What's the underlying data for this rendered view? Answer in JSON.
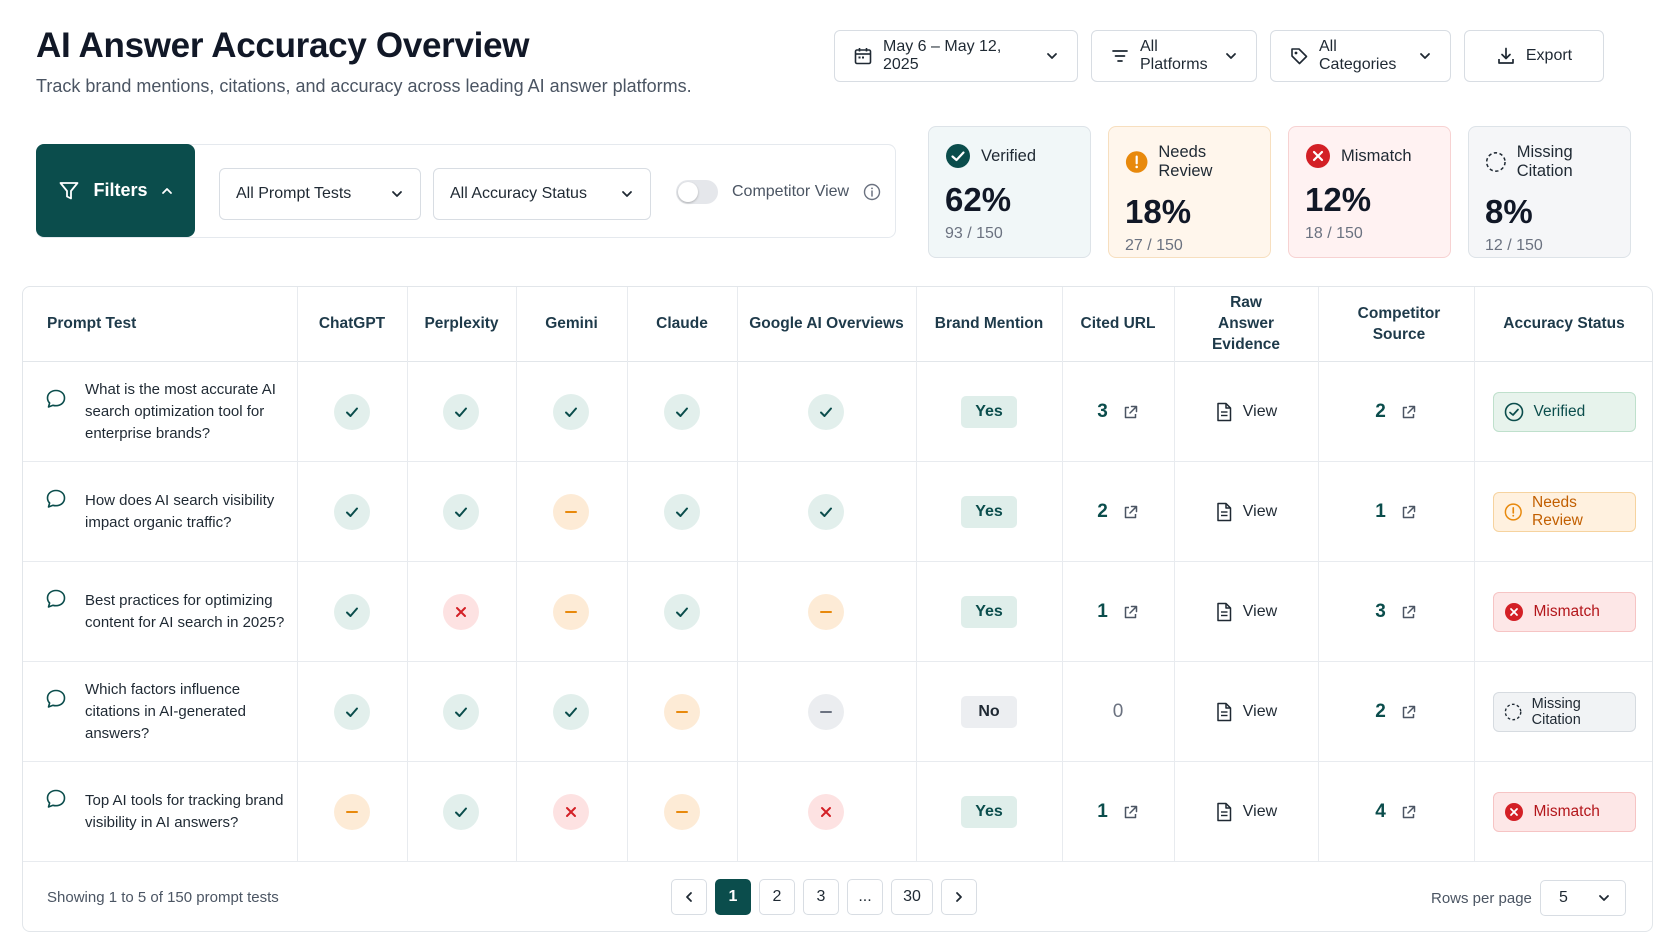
{
  "header": {
    "title": "AI Answer Accuracy Overview",
    "subtitle": "Track brand mentions, citations, and accuracy across leading AI answer platforms."
  },
  "toolbar": {
    "date_range": "May 6 – May 12, 2025",
    "platforms": "All Platforms",
    "categories": "All Categories",
    "export": "Export"
  },
  "filters": {
    "button": "Filters",
    "prompt_tests": "All Prompt Tests",
    "accuracy_status": "All Accuracy Status",
    "competitor_view": "Competitor View"
  },
  "stats": [
    {
      "label": "Verified",
      "value": "62%",
      "sub": "93 / 150",
      "color": "#0b4d4c"
    },
    {
      "label": "Needs Review",
      "value": "18%",
      "sub": "27 / 150",
      "color": "#e8890c"
    },
    {
      "label": "Mismatch",
      "value": "12%",
      "sub": "18 / 150",
      "color": "#d32026"
    },
    {
      "label": "Missing Citation",
      "value": "8%",
      "sub": "12 / 150",
      "color": "#1f2933"
    }
  ],
  "table": {
    "columns": [
      "Prompt Test",
      "ChatGPT",
      "Perplexity",
      "Gemini",
      "Claude",
      "Google AI Overviews",
      "Brand Mention",
      "Cited URL",
      "Raw Answer Evidence",
      "Competitor Source",
      "Accuracy Status"
    ],
    "view_label": "View",
    "rows": [
      {
        "prompt": "What is the most accurate AI search optimization tool for enterprise brands?",
        "platforms": [
          "check",
          "check",
          "check",
          "check",
          "check"
        ],
        "brand": "Yes",
        "cited": "3",
        "competitor": "2",
        "status": "Verified",
        "status_type": "verified"
      },
      {
        "prompt": "How does AI search visibility impact organic traffic?",
        "platforms": [
          "check",
          "check",
          "partial",
          "check",
          "check"
        ],
        "brand": "Yes",
        "cited": "2",
        "competitor": "1",
        "status": "Needs Review",
        "status_type": "review"
      },
      {
        "prompt": "Best practices for optimizing content for AI search in 2025?",
        "platforms": [
          "check",
          "cross",
          "partial",
          "check",
          "partial"
        ],
        "brand": "Yes",
        "cited": "1",
        "competitor": "3",
        "status": "Mismatch",
        "status_type": "mismatch"
      },
      {
        "prompt": "Which factors influence citations in AI-generated answers?",
        "platforms": [
          "check",
          "check",
          "check",
          "partial",
          "none"
        ],
        "brand": "No",
        "cited": "0",
        "competitor": "2",
        "status": "Missing Citation",
        "status_type": "missing"
      },
      {
        "prompt": "Top AI tools for tracking brand visibility in AI answers?",
        "platforms": [
          "partial",
          "check",
          "cross",
          "partial",
          "cross"
        ],
        "brand": "Yes",
        "cited": "1",
        "competitor": "4",
        "status": "Mismatch",
        "status_type": "mismatch"
      }
    ]
  },
  "footer": {
    "showing": "Showing 1 to 5 of 150 prompt tests",
    "pages": [
      "1",
      "2",
      "3",
      "...",
      "30"
    ],
    "rows_per_page_label": "Rows per page",
    "rows_per_page": "5"
  }
}
